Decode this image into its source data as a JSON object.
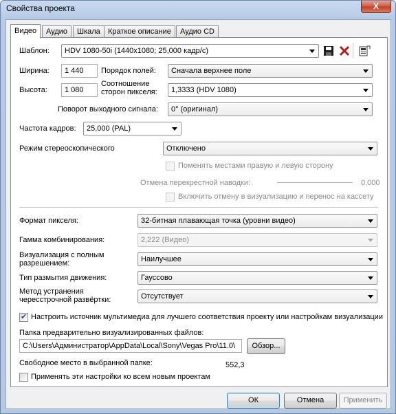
{
  "window": {
    "title": "Свойства проекта",
    "close_glyph": "X"
  },
  "tabs": [
    "Видео",
    "Аудио",
    "Шкала",
    "Краткое описание",
    "Аудио CD"
  ],
  "video": {
    "template_label": "Шаблон:",
    "template_value": "HDV 1080-50i (1440x1080; 25,000 кадр/с)",
    "width_label": "Ширина:",
    "width_value": "1 440",
    "height_label": "Высота:",
    "height_value": "1 080",
    "field_order_label": "Порядок полей:",
    "field_order_value": "Сначала верхнее поле",
    "pixel_aspect_label_1": "Соотношение",
    "pixel_aspect_label_2": "сторон пикселя:",
    "pixel_aspect_value": "1,3333 (HDV 1080)",
    "rotation_label": "Поворот выходного сигнала:",
    "rotation_value": "0° (оригинал)",
    "frame_rate_label": "Частота кадров:",
    "frame_rate_value": "25,000 (PAL)",
    "stereo_label": "Режим стереоскопического",
    "stereo_value": "Отключено",
    "swap_lr_label": "Поменять местами правую и левую сторону",
    "crossover_label": "Отмена перекрестной наводки:",
    "crossover_value": "0,000",
    "crossover_enable_label": "Включить отмену в визуализацию и перенос на кассету",
    "pixel_format_label": "Формат пикселя:",
    "pixel_format_value": "32-битная плавающая точка (уровни видео)",
    "gamma_label": "Гамма комбинирования:",
    "gamma_value": "2,222 (Видео)",
    "fullres_label_1": "Визуализация с полным",
    "fullres_label_2": "разрешением:",
    "fullres_value": "Наилучшее",
    "motion_blur_label": "Тип размытия движения:",
    "motion_blur_value": "Гауссово",
    "deinterlace_label_1": "Метод устранения",
    "deinterlace_label_2": "чересстрочной развёртки:",
    "deinterlace_value": "Отсутствует",
    "adjust_media_label": "Настроить источник мультимедиа для лучшего соответствия проекту или настройкам визуализации",
    "prerender_label": "Папка предварительно визуализированных файлов:",
    "prerender_path": "C:\\Users\\Администратор\\AppData\\Local\\Sony\\Vegas Pro\\11.0\\",
    "browse_label": "Обзор...",
    "free_space_label": "Свободное место в выбранной папке:",
    "free_space_value": "552,3",
    "apply_all_label": "Применять эти настройки ко всем новым проектам"
  },
  "buttons": {
    "ok": "ОК",
    "cancel": "Отмена",
    "apply": "Применить"
  },
  "icons": [
    "save-icon",
    "delete-icon",
    "match-media-icon"
  ],
  "colors": {
    "title_bar": "#b7cbe6",
    "close_button": "#c95a46",
    "panel": "#ffffff"
  }
}
